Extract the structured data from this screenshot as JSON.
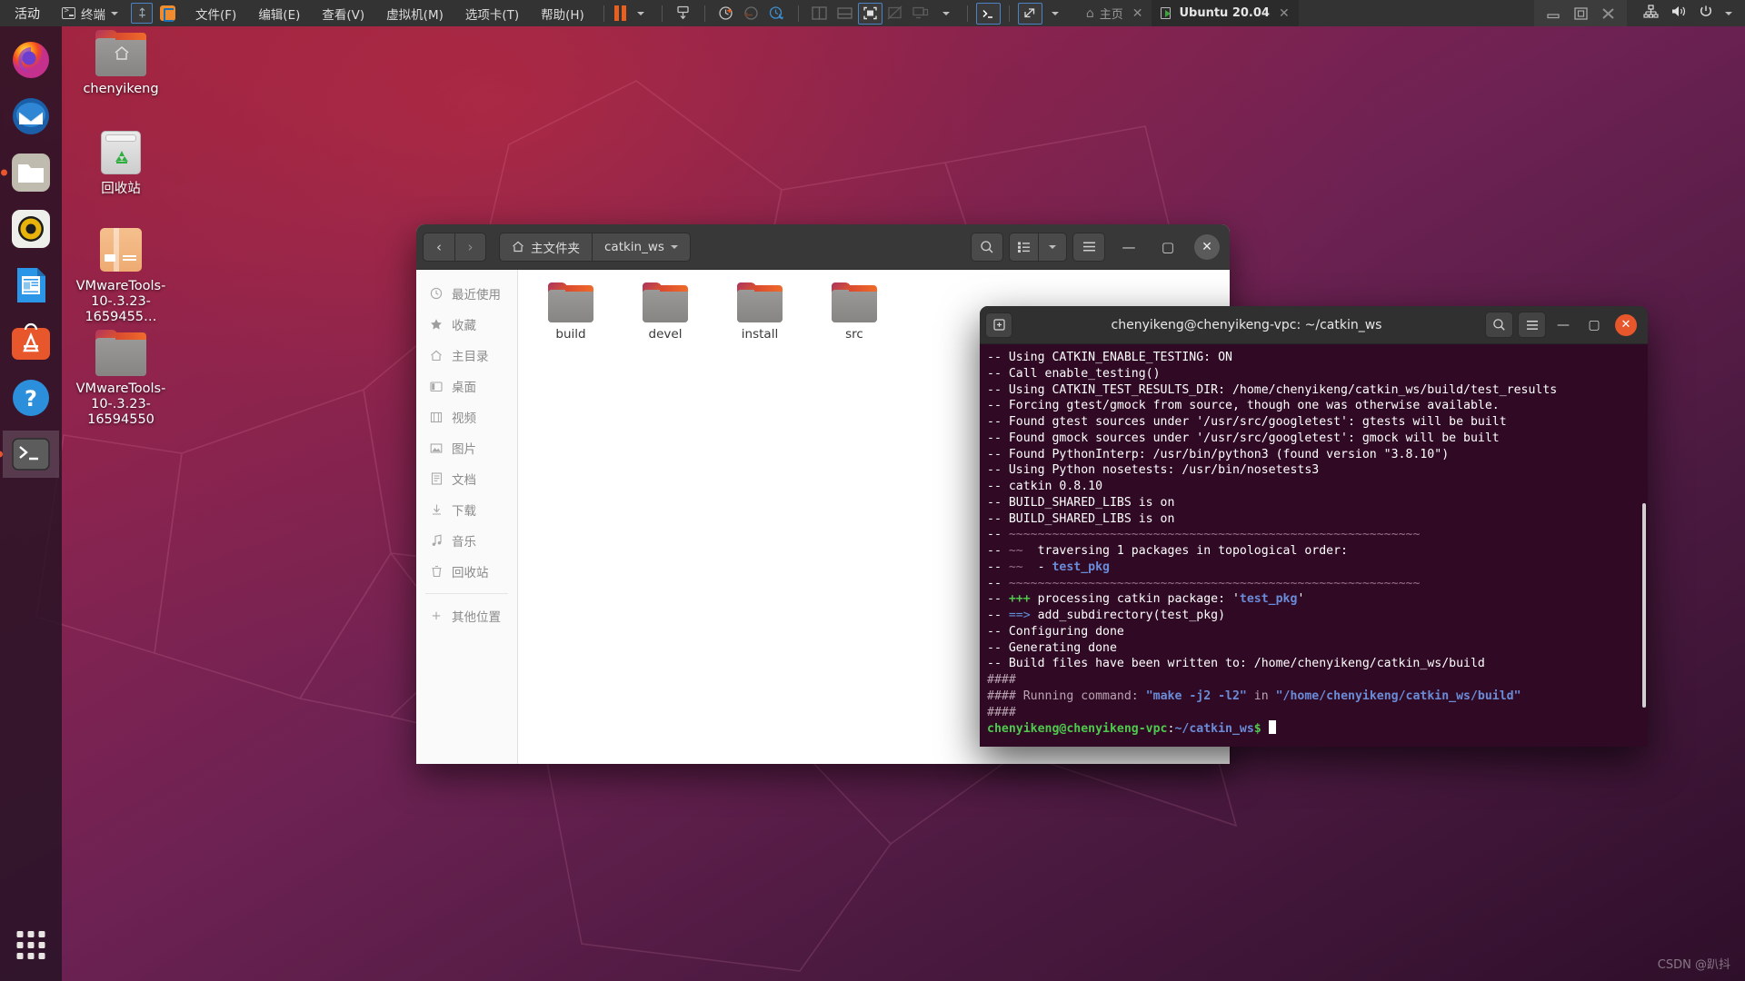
{
  "vmware": {
    "activities_label": "活动",
    "app_label": "终端",
    "menus": [
      "文件(F)",
      "编辑(E)",
      "查看(V)",
      "虚拟机(M)",
      "选项卡(T)",
      "帮助(H)"
    ],
    "toolbar_icons": [
      "pause-icon",
      "dropdown-caret-icon",
      "snapshot-icon",
      "take-snapshot-icon",
      "revert-snapshot-icon",
      "snapshot-manager-icon",
      "split-view-icon",
      "stacked-view-icon",
      "fullscreen-icon",
      "unity-mode-icon",
      "multiple-monitors-icon",
      "console-icon",
      "expand-icon"
    ],
    "tabs": [
      {
        "label": "主页",
        "icon": "home-icon",
        "active": false
      },
      {
        "label": "Ubuntu 20.04",
        "icon": "vm-running-icon",
        "active": true
      }
    ],
    "window_buttons": [
      "minimize-icon",
      "restore-icon",
      "close-icon"
    ],
    "system_icons": [
      "network-icon",
      "volume-icon",
      "power-icon",
      "chevron-down-icon"
    ]
  },
  "dock": {
    "items": [
      {
        "name": "firefox",
        "running": false
      },
      {
        "name": "thunderbird",
        "running": false
      },
      {
        "name": "files",
        "running": true
      },
      {
        "name": "rhythmbox",
        "running": false
      },
      {
        "name": "libreoffice-writer",
        "running": false
      },
      {
        "name": "ubuntu-software",
        "running": false
      },
      {
        "name": "help",
        "running": false
      },
      {
        "name": "terminal",
        "running": true
      }
    ],
    "show_apps_label": "显示应用程序"
  },
  "desktop_icons": [
    {
      "label": "chenyikeng",
      "type": "home-folder"
    },
    {
      "label": "回收站",
      "type": "trash"
    },
    {
      "label": "VMwareTools-10-.3.23-1659455…",
      "type": "archive"
    },
    {
      "label": "VMwareTools-10-.3.23-16594550",
      "type": "folder"
    }
  ],
  "file_manager": {
    "nav": {
      "back": "‹",
      "forward": "›"
    },
    "breadcrumbs": [
      {
        "label": "主文件夹",
        "icon": "home-icon"
      },
      {
        "label": "catkin_ws",
        "icon": "chevron-down-icon"
      }
    ],
    "header_buttons": [
      "search-icon",
      "list-view-icon",
      "view-dropdown-icon",
      "hamburger-menu-icon"
    ],
    "window_buttons": {
      "minimize": "—",
      "maximize": "▢",
      "close": "✕"
    },
    "sidebar": [
      {
        "label": "最近使用",
        "icon": "clock-icon"
      },
      {
        "label": "收藏",
        "icon": "star-icon"
      },
      {
        "label": "主目录",
        "icon": "home-icon"
      },
      {
        "label": "桌面",
        "icon": "desktop-icon"
      },
      {
        "label": "视频",
        "icon": "video-icon"
      },
      {
        "label": "图片",
        "icon": "image-icon"
      },
      {
        "label": "文档",
        "icon": "document-icon"
      },
      {
        "label": "下载",
        "icon": "download-icon"
      },
      {
        "label": "音乐",
        "icon": "music-icon"
      },
      {
        "label": "回收站",
        "icon": "trash-icon"
      }
    ],
    "sidebar_footer": {
      "label": "其他位置",
      "icon": "plus-icon"
    },
    "files": [
      {
        "label": "build",
        "type": "folder"
      },
      {
        "label": "devel",
        "type": "folder"
      },
      {
        "label": "install",
        "type": "folder"
      },
      {
        "label": "src",
        "type": "folder"
      }
    ]
  },
  "terminal": {
    "title": "chenyikeng@chenyikeng-vpc: ~/catkin_ws",
    "header_buttons": [
      "new-tab-icon",
      "search-icon",
      "hamburger-menu-icon"
    ],
    "window_buttons": {
      "minimize": "—",
      "maximize": "▢",
      "close": "✕"
    },
    "lines": [
      [
        {
          "t": "-- Using CATKIN_ENABLE_TESTING: ON",
          "c": "t-white"
        }
      ],
      [
        {
          "t": "-- Call enable_testing()",
          "c": "t-white"
        }
      ],
      [
        {
          "t": "-- Using CATKIN_TEST_RESULTS_DIR: /home/chenyikeng/catkin_ws/build/test_results",
          "c": "t-white"
        }
      ],
      [
        {
          "t": "-- Forcing gtest/gmock from source, though one was otherwise available.",
          "c": "t-white"
        }
      ],
      [
        {
          "t": "-- Found gtest sources under '/usr/src/googletest': gtests will be built",
          "c": "t-white"
        }
      ],
      [
        {
          "t": "-- Found gmock sources under '/usr/src/googletest': gmock will be built",
          "c": "t-white"
        }
      ],
      [
        {
          "t": "-- Found PythonInterp: /usr/bin/python3 (found version \"3.8.10\")",
          "c": "t-white"
        }
      ],
      [
        {
          "t": "-- Using Python nosetests: /usr/bin/nosetests3",
          "c": "t-white"
        }
      ],
      [
        {
          "t": "-- catkin 0.8.10",
          "c": "t-white"
        }
      ],
      [
        {
          "t": "-- BUILD_SHARED_LIBS is on",
          "c": "t-white"
        }
      ],
      [
        {
          "t": "-- BUILD_SHARED_LIBS is on",
          "c": "t-white"
        }
      ],
      [
        {
          "t": "-- ",
          "c": "t-white"
        },
        {
          "t": "~~~~~~~~~~~~~~~~~~~~~~~~~~~~~~~~~~~~~~~~~~~~~~~~~~~~~~~~~",
          "c": "t-dim"
        }
      ],
      [
        {
          "t": "-- ",
          "c": "t-white"
        },
        {
          "t": "~~  ",
          "c": "t-dim"
        },
        {
          "t": "traversing 1 packages in topological order:",
          "c": "t-white"
        }
      ],
      [
        {
          "t": "-- ",
          "c": "t-white"
        },
        {
          "t": "~~  ",
          "c": "t-dim"
        },
        {
          "t": "- ",
          "c": "t-white"
        },
        {
          "t": "test_pkg",
          "c": "t-blue"
        }
      ],
      [
        {
          "t": "-- ",
          "c": "t-white"
        },
        {
          "t": "~~~~~~~~~~~~~~~~~~~~~~~~~~~~~~~~~~~~~~~~~~~~~~~~~~~~~~~~~",
          "c": "t-dim"
        }
      ],
      [
        {
          "t": "-- ",
          "c": "t-white"
        },
        {
          "t": "+++ ",
          "c": "t-green"
        },
        {
          "t": "processing catkin package: '",
          "c": "t-white"
        },
        {
          "t": "test_pkg",
          "c": "t-blue"
        },
        {
          "t": "'",
          "c": "t-white"
        }
      ],
      [
        {
          "t": "-- ",
          "c": "t-white"
        },
        {
          "t": "==> ",
          "c": "t-cyan"
        },
        {
          "t": "add_subdirectory(test_pkg)",
          "c": "t-white"
        }
      ],
      [
        {
          "t": "-- Configuring done",
          "c": "t-white"
        }
      ],
      [
        {
          "t": "-- Generating done",
          "c": "t-white"
        }
      ],
      [
        {
          "t": "-- Build files have been written to: /home/chenyikeng/catkin_ws/build",
          "c": "t-white"
        }
      ],
      [
        {
          "t": "####",
          "c": "t-gray"
        }
      ],
      [
        {
          "t": "#### ",
          "c": "t-gray"
        },
        {
          "t": "Running command: ",
          "c": "t-gray"
        },
        {
          "t": "\"make -j2 -l2\"",
          "c": "t-blue"
        },
        {
          "t": " in ",
          "c": "t-gray"
        },
        {
          "t": "\"/home/chenyikeng/catkin_ws/build\"",
          "c": "t-blue"
        }
      ],
      [
        {
          "t": "####",
          "c": "t-gray"
        }
      ]
    ],
    "prompt": {
      "user_host": "chenyikeng@chenyikeng-vpc",
      "separator": ":",
      "path": "~/catkin_ws",
      "sigil": "$",
      "input": ""
    }
  },
  "watermark": "CSDN @趴抖",
  "colors": {
    "accent_orange": "#e8562c",
    "vmware_chrome": "#333333",
    "terminal_bg": "#300a24",
    "desktop_gradient_start": "#a4243f",
    "desktop_gradient_end": "#2e0f2a"
  }
}
